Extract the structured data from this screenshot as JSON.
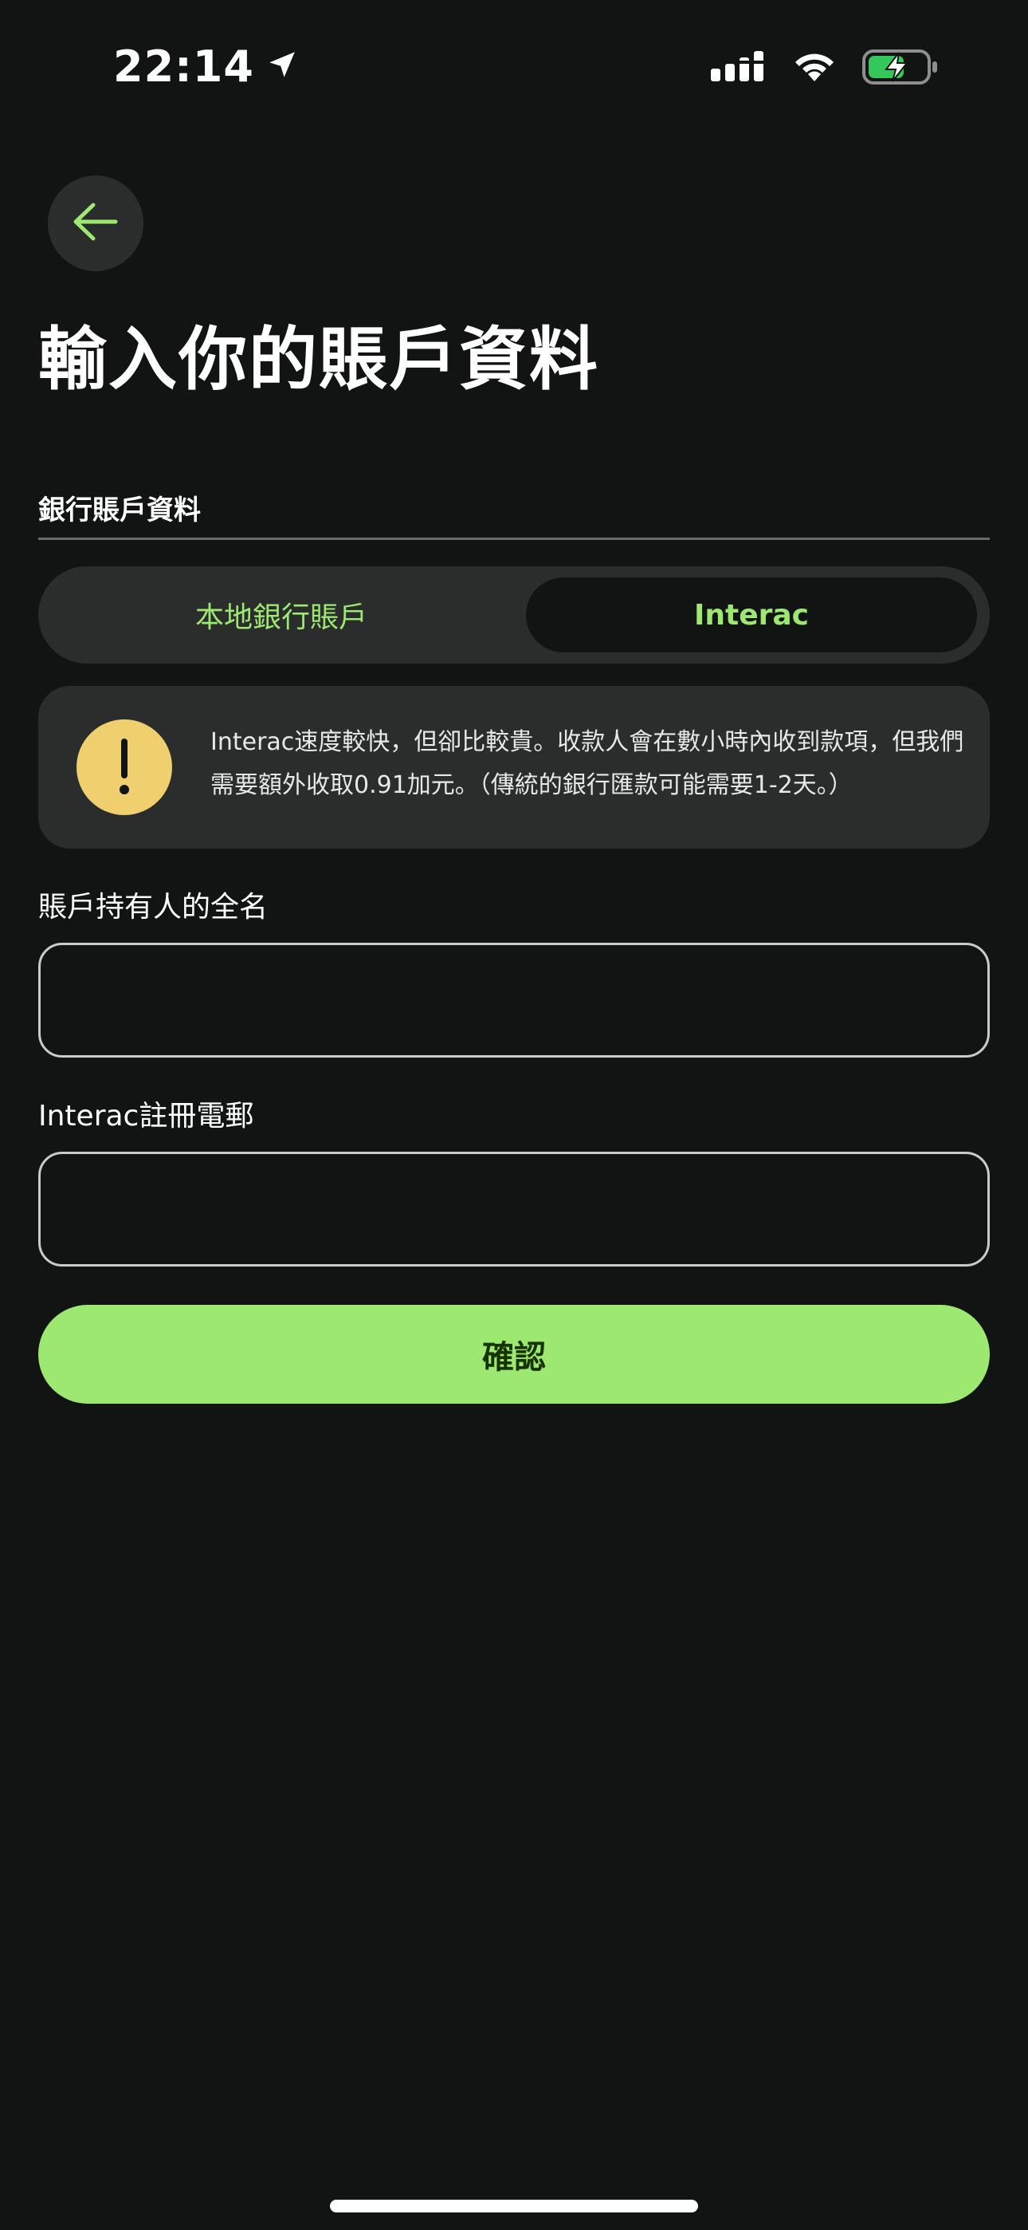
{
  "status_bar": {
    "time": "22:14",
    "battery_color": "#34c759"
  },
  "header": {
    "title": "輸入你的賬戶資料"
  },
  "section": {
    "label": "銀行賬戶資料"
  },
  "segmented": {
    "options": [
      "本地銀行賬戶",
      "Interac"
    ],
    "selected": "Interac"
  },
  "notice": {
    "text": "Interac速度較快，但卻比較貴。收款人會在數小時內收到款項，但我們需要額外收取0.91加元。（傳統的銀行匯款可能需要1-2天。）"
  },
  "form": {
    "full_name_label": "賬戶持有人的全名",
    "full_name_value": "",
    "email_label": "Interac註冊電郵",
    "email_value": ""
  },
  "actions": {
    "confirm_label": "確認"
  },
  "colors": {
    "accent": "#9de870",
    "background": "#121413",
    "card": "#2b2d2c",
    "warning": "#f0d06e"
  }
}
